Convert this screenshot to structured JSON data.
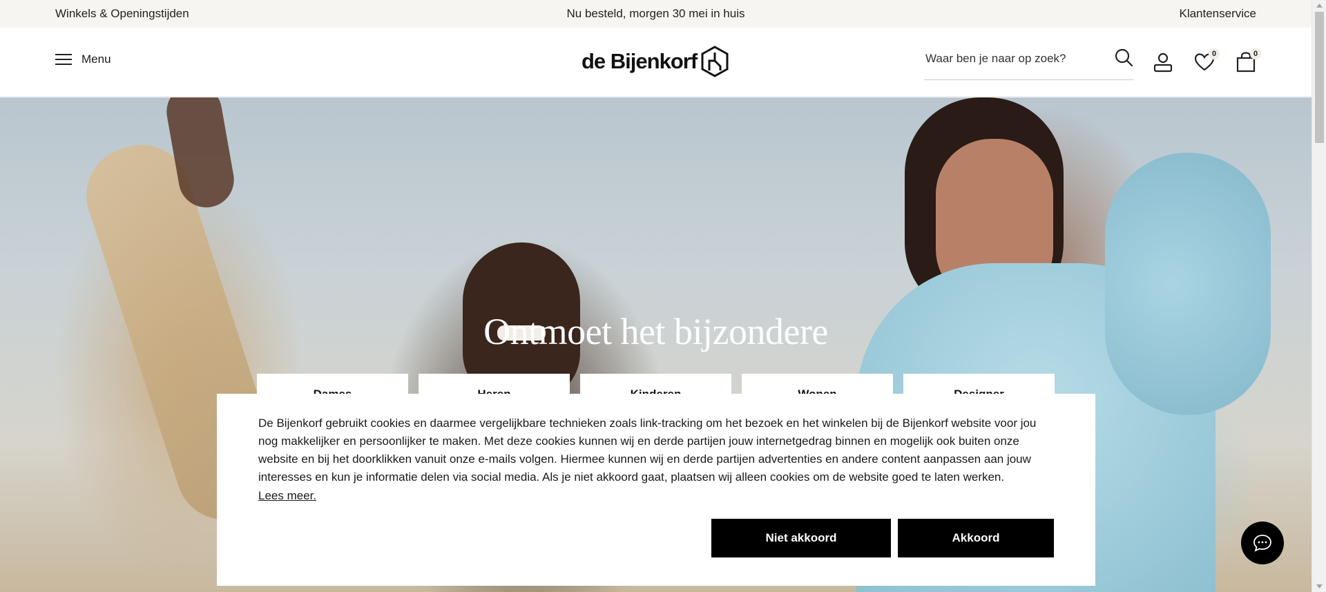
{
  "topbar": {
    "stores_link": "Winkels & Openingstijden",
    "delivery_message": "Nu besteld, morgen 30 mei in huis",
    "customer_service_link": "Klantenservice"
  },
  "header": {
    "menu_label": "Menu",
    "logo_text": "de Bijenkorf",
    "search_placeholder": "Waar ben je naar op zoek?",
    "wishlist_count": "0",
    "cart_count": "0"
  },
  "hero": {
    "title": "Ontmoet het bijzondere",
    "categories": [
      "Dames",
      "Heren",
      "Kinderen",
      "Wonen",
      "Designer"
    ]
  },
  "cookie": {
    "text": "De Bijenkorf gebruikt cookies en daarmee vergelijkbare technieken zoals link-tracking om het bezoek en het winkelen bij de Bijenkorf website voor jou nog makkelijker en persoonlijker te maken. Met deze cookies kunnen wij en derde partijen jouw internetgedrag binnen en mogelijk ook buiten onze website en bij het doorklikken vanuit onze e-mails volgen. Hiermee kunnen wij en derde partijen advertenties en andere content aanpassen aan jouw interesses en kun je informatie delen via social media. Als je niet akkoord gaat, plaatsen wij alleen cookies om de website goed te laten werken.",
    "read_more": "Lees meer.",
    "decline_label": "Niet akkoord",
    "accept_label": "Akkoord"
  },
  "icons": {
    "menu": "hamburger-icon",
    "search": "search-icon",
    "account": "user-icon",
    "wishlist": "heart-icon",
    "cart": "shopping-bag-icon",
    "chat": "chat-bubble-icon"
  },
  "colors": {
    "topbar_bg": "#f7f5f2",
    "button_bg": "#000000",
    "badge_bg": "#f1ece5"
  }
}
